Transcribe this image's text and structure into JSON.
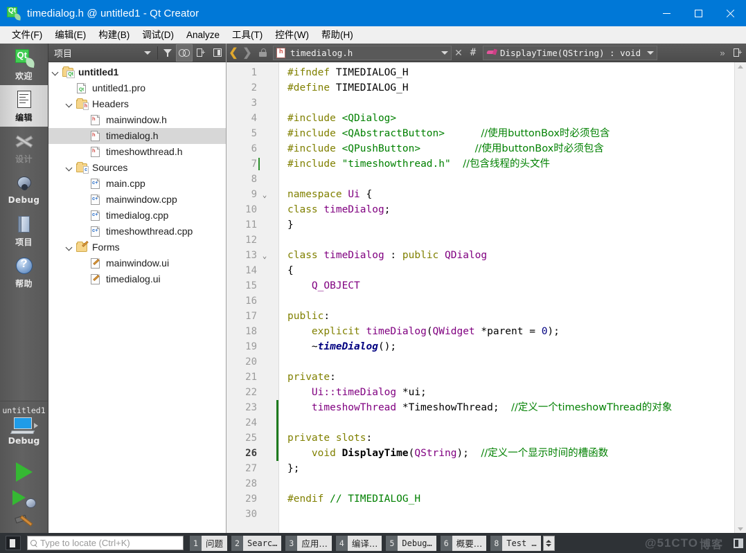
{
  "window": {
    "title": "timedialog.h @ untitled1 - Qt Creator",
    "app_icon": "qt-logo-icon",
    "minimize": "minimize-icon",
    "maximize": "maximize-icon",
    "close": "close-icon",
    "accent": "#0078d7"
  },
  "menubar": {
    "items": [
      {
        "label": "文件(F)",
        "mnemonic": "F"
      },
      {
        "label": "编辑(E)",
        "mnemonic": "E"
      },
      {
        "label": "构建(B)",
        "mnemonic": "B"
      },
      {
        "label": "调试(D)",
        "mnemonic": "D"
      },
      {
        "label": "Analyze",
        "mnemonic": "A"
      },
      {
        "label": "工具(T)",
        "mnemonic": "T"
      },
      {
        "label": "控件(W)",
        "mnemonic": "W"
      },
      {
        "label": "帮助(H)",
        "mnemonic": "H"
      }
    ]
  },
  "modebar": {
    "modes": [
      {
        "label": "欢迎",
        "icon": "qt-welcome-icon",
        "state": "normal"
      },
      {
        "label": "编辑",
        "icon": "edit-document-icon",
        "state": "active"
      },
      {
        "label": "设计",
        "icon": "design-brush-icon",
        "state": "disabled"
      },
      {
        "label": "Debug",
        "icon": "debug-bug-icon",
        "state": "normal"
      },
      {
        "label": "项目",
        "icon": "projects-book-icon",
        "state": "normal"
      },
      {
        "label": "帮助",
        "icon": "help-question-icon",
        "state": "normal"
      }
    ],
    "kit": {
      "project": "untitled1",
      "build_config": "Debug",
      "target_icon": "computer-target-icon"
    },
    "actions": [
      {
        "name": "run-button",
        "icon": "green-play-icon"
      },
      {
        "name": "debug-button",
        "icon": "play-bug-icon"
      },
      {
        "name": "build-button",
        "icon": "hammer-icon"
      }
    ]
  },
  "project_pane": {
    "title": "项目",
    "toolbar": [
      {
        "name": "view-selector-dropdown",
        "icon": "chevron-down-icon"
      },
      {
        "name": "filter-button",
        "icon": "filter-icon"
      },
      {
        "name": "sync-with-editor-button",
        "icon": "link-icon"
      },
      {
        "name": "split-button",
        "icon": "split-add-icon"
      },
      {
        "name": "close-sidebar-button",
        "icon": "panel-icon"
      }
    ],
    "tree": [
      {
        "label": "untitled1",
        "indent": 0,
        "expander": "expanded",
        "icon": "qt-project-folder-icon",
        "bold": true,
        "selected": false
      },
      {
        "label": "untitled1.pro",
        "indent": 1,
        "expander": "none",
        "icon": "pro-file-icon",
        "bold": false,
        "selected": false
      },
      {
        "label": "Headers",
        "indent": 1,
        "expander": "expanded",
        "icon": "headers-folder-icon",
        "bold": false,
        "selected": false
      },
      {
        "label": "mainwindow.h",
        "indent": 2,
        "expander": "none",
        "icon": "h-file-icon",
        "bold": false,
        "selected": false
      },
      {
        "label": "timedialog.h",
        "indent": 2,
        "expander": "none",
        "icon": "h-file-icon",
        "bold": false,
        "selected": true
      },
      {
        "label": "timeshowthread.h",
        "indent": 2,
        "expander": "none",
        "icon": "h-file-icon",
        "bold": false,
        "selected": false
      },
      {
        "label": "Sources",
        "indent": 1,
        "expander": "expanded",
        "icon": "sources-folder-icon",
        "bold": false,
        "selected": false
      },
      {
        "label": "main.cpp",
        "indent": 2,
        "expander": "none",
        "icon": "cpp-file-icon",
        "bold": false,
        "selected": false
      },
      {
        "label": "mainwindow.cpp",
        "indent": 2,
        "expander": "none",
        "icon": "cpp-file-icon",
        "bold": false,
        "selected": false
      },
      {
        "label": "timedialog.cpp",
        "indent": 2,
        "expander": "none",
        "icon": "cpp-file-icon",
        "bold": false,
        "selected": false
      },
      {
        "label": "timeshowthread.cpp",
        "indent": 2,
        "expander": "none",
        "icon": "cpp-file-icon",
        "bold": false,
        "selected": false
      },
      {
        "label": "Forms",
        "indent": 1,
        "expander": "expanded",
        "icon": "forms-folder-icon",
        "bold": false,
        "selected": false
      },
      {
        "label": "mainwindow.ui",
        "indent": 2,
        "expander": "none",
        "icon": "ui-file-icon",
        "bold": false,
        "selected": false
      },
      {
        "label": "timedialog.ui",
        "indent": 2,
        "expander": "none",
        "icon": "ui-file-icon",
        "bold": false,
        "selected": false
      }
    ]
  },
  "editor": {
    "toolbar": {
      "go_back_icon": "chevron-left-icon",
      "go_forward_icon": "chevron-right-icon",
      "lock_icon": "unlocked-icon",
      "file_combo": "timedialog.h",
      "file_icon": "h-file-icon",
      "close_icon": "close-icon",
      "hash_label": "#",
      "symbol_combo": "DisplayTime(QString) : void",
      "symbol_icon": "slot-icon",
      "overflow_icon": "double-chevron-icon",
      "split_icon": "split-add-icon"
    },
    "cursor_line": 26,
    "lines": [
      {
        "n": 1,
        "fold": "",
        "tokens": [
          {
            "t": "#ifndef ",
            "c": "pre"
          },
          {
            "t": "TIMEDIALOG_H",
            "c": "plain"
          }
        ]
      },
      {
        "n": 2,
        "fold": "",
        "tokens": [
          {
            "t": "#define ",
            "c": "pre"
          },
          {
            "t": "TIMEDIALOG_H",
            "c": "plain"
          }
        ]
      },
      {
        "n": 3,
        "fold": "",
        "tokens": []
      },
      {
        "n": 4,
        "fold": "",
        "tokens": [
          {
            "t": "#include ",
            "c": "pre"
          },
          {
            "t": "<QDialog>",
            "c": "inc"
          }
        ]
      },
      {
        "n": 5,
        "fold": "",
        "tokens": [
          {
            "t": "#include ",
            "c": "pre"
          },
          {
            "t": "<QAbstractButton>",
            "c": "inc"
          },
          {
            "t": "      ",
            "c": "plain"
          },
          {
            "t": "//使用buttonBox时必须包含",
            "c": "cmt"
          }
        ]
      },
      {
        "n": 6,
        "fold": "",
        "tokens": [
          {
            "t": "#include ",
            "c": "pre"
          },
          {
            "t": "<QPushButton>",
            "c": "inc"
          },
          {
            "t": "         ",
            "c": "plain"
          },
          {
            "t": "//使用buttonBox时必须包含",
            "c": "cmt"
          }
        ]
      },
      {
        "n": 7,
        "fold": "",
        "tokens": [
          {
            "t": "#include ",
            "c": "pre"
          },
          {
            "t": "\"timeshowthread.h\"",
            "c": "str"
          },
          {
            "t": "  ",
            "c": "plain"
          },
          {
            "t": "//包含线程的头文件",
            "c": "cmt"
          }
        ]
      },
      {
        "n": 8,
        "fold": "",
        "tokens": []
      },
      {
        "n": 9,
        "fold": "v",
        "tokens": [
          {
            "t": "namespace ",
            "c": "key"
          },
          {
            "t": "Ui",
            "c": "type"
          },
          {
            "t": " {",
            "c": "plain"
          }
        ]
      },
      {
        "n": 10,
        "fold": "",
        "tokens": [
          {
            "t": "class ",
            "c": "key"
          },
          {
            "t": "timeDialog",
            "c": "type"
          },
          {
            "t": ";",
            "c": "plain"
          }
        ]
      },
      {
        "n": 11,
        "fold": "",
        "tokens": [
          {
            "t": "}",
            "c": "plain"
          }
        ]
      },
      {
        "n": 12,
        "fold": "",
        "tokens": []
      },
      {
        "n": 13,
        "fold": "v",
        "tokens": [
          {
            "t": "class ",
            "c": "key"
          },
          {
            "t": "timeDialog",
            "c": "type"
          },
          {
            "t": " : ",
            "c": "plain"
          },
          {
            "t": "public ",
            "c": "key"
          },
          {
            "t": "QDialog",
            "c": "type"
          }
        ]
      },
      {
        "n": 14,
        "fold": "",
        "tokens": [
          {
            "t": "{",
            "c": "plain"
          }
        ]
      },
      {
        "n": 15,
        "fold": "",
        "tokens": [
          {
            "t": "    Q_OBJECT",
            "c": "type"
          }
        ]
      },
      {
        "n": 16,
        "fold": "",
        "tokens": []
      },
      {
        "n": 17,
        "fold": "",
        "tokens": [
          {
            "t": "public",
            "c": "key"
          },
          {
            "t": ":",
            "c": "plain"
          }
        ]
      },
      {
        "n": 18,
        "fold": "",
        "tokens": [
          {
            "t": "    ",
            "c": "plain"
          },
          {
            "t": "explicit ",
            "c": "key"
          },
          {
            "t": "timeDialog",
            "c": "type"
          },
          {
            "t": "(",
            "c": "plain"
          },
          {
            "t": "QWidget",
            "c": "type"
          },
          {
            "t": " *parent = ",
            "c": "plain"
          },
          {
            "t": "0",
            "c": "num"
          },
          {
            "t": ");",
            "c": "plain"
          }
        ]
      },
      {
        "n": 19,
        "fold": "",
        "tokens": [
          {
            "t": "    ~",
            "c": "plain"
          },
          {
            "t": "timeDialog",
            "c": "dtor"
          },
          {
            "t": "();",
            "c": "plain"
          }
        ]
      },
      {
        "n": 20,
        "fold": "",
        "tokens": []
      },
      {
        "n": 21,
        "fold": "",
        "tokens": [
          {
            "t": "private",
            "c": "key"
          },
          {
            "t": ":",
            "c": "plain"
          }
        ]
      },
      {
        "n": 22,
        "fold": "",
        "tokens": [
          {
            "t": "    ",
            "c": "plain"
          },
          {
            "t": "Ui::timeDialog",
            "c": "type"
          },
          {
            "t": " *ui;",
            "c": "plain"
          }
        ]
      },
      {
        "n": 23,
        "fold": "",
        "tokens": [
          {
            "t": "    ",
            "c": "plain"
          },
          {
            "t": "timeshowThread",
            "c": "type"
          },
          {
            "t": " *TimeshowThread;",
            "c": "plain"
          },
          {
            "t": "  ",
            "c": "plain"
          },
          {
            "t": "//定义一个timeshowThread的对象",
            "c": "cmt"
          }
        ]
      },
      {
        "n": 24,
        "fold": "",
        "tokens": []
      },
      {
        "n": 25,
        "fold": "",
        "tokens": [
          {
            "t": "private slots",
            "c": "key"
          },
          {
            "t": ":",
            "c": "plain"
          }
        ]
      },
      {
        "n": 26,
        "fold": "",
        "tokens": [
          {
            "t": "    ",
            "c": "plain"
          },
          {
            "t": "void ",
            "c": "key"
          },
          {
            "t": "DisplayTime",
            "c": "fn"
          },
          {
            "t": "(",
            "c": "plain"
          },
          {
            "t": "QString",
            "c": "type"
          },
          {
            "t": ");",
            "c": "plain"
          },
          {
            "t": "  ",
            "c": "plain"
          },
          {
            "t": "//定义一个显示时间的槽函数",
            "c": "cmt"
          }
        ]
      },
      {
        "n": 27,
        "fold": "",
        "tokens": [
          {
            "t": "};",
            "c": "plain"
          }
        ]
      },
      {
        "n": 28,
        "fold": "",
        "tokens": []
      },
      {
        "n": 29,
        "fold": "",
        "tokens": [
          {
            "t": "#endif ",
            "c": "pre"
          },
          {
            "t": "// TIMEDIALOG_H",
            "c": "cmt"
          }
        ]
      },
      {
        "n": 30,
        "fold": "",
        "tokens": []
      }
    ],
    "scrollbar": {
      "up_icon": "chevron-up-icon",
      "down_icon": "chevron-down-icon"
    }
  },
  "statusbar": {
    "sidebar_toggle_icon": "panel-toggle-icon",
    "locator_placeholder": "Type to locate (Ctrl+K)",
    "locator_icon": "search-icon",
    "outputs": [
      {
        "num": "1",
        "label": "问题",
        "mono": false
      },
      {
        "num": "2",
        "label": "Searc…",
        "mono": true
      },
      {
        "num": "3",
        "label": "应用…",
        "mono": false
      },
      {
        "num": "4",
        "label": "编译…",
        "mono": false
      },
      {
        "num": "5",
        "label": "Debug…",
        "mono": true
      },
      {
        "num": "6",
        "label": "概要…",
        "mono": false
      },
      {
        "num": "8",
        "label": "Test …",
        "mono": true
      }
    ],
    "spinner_icon": "up-down-arrows-icon",
    "watermark_latin": "@51CTO",
    "watermark_cjk": "博客",
    "right_icon": "panel-toggle-icon"
  }
}
